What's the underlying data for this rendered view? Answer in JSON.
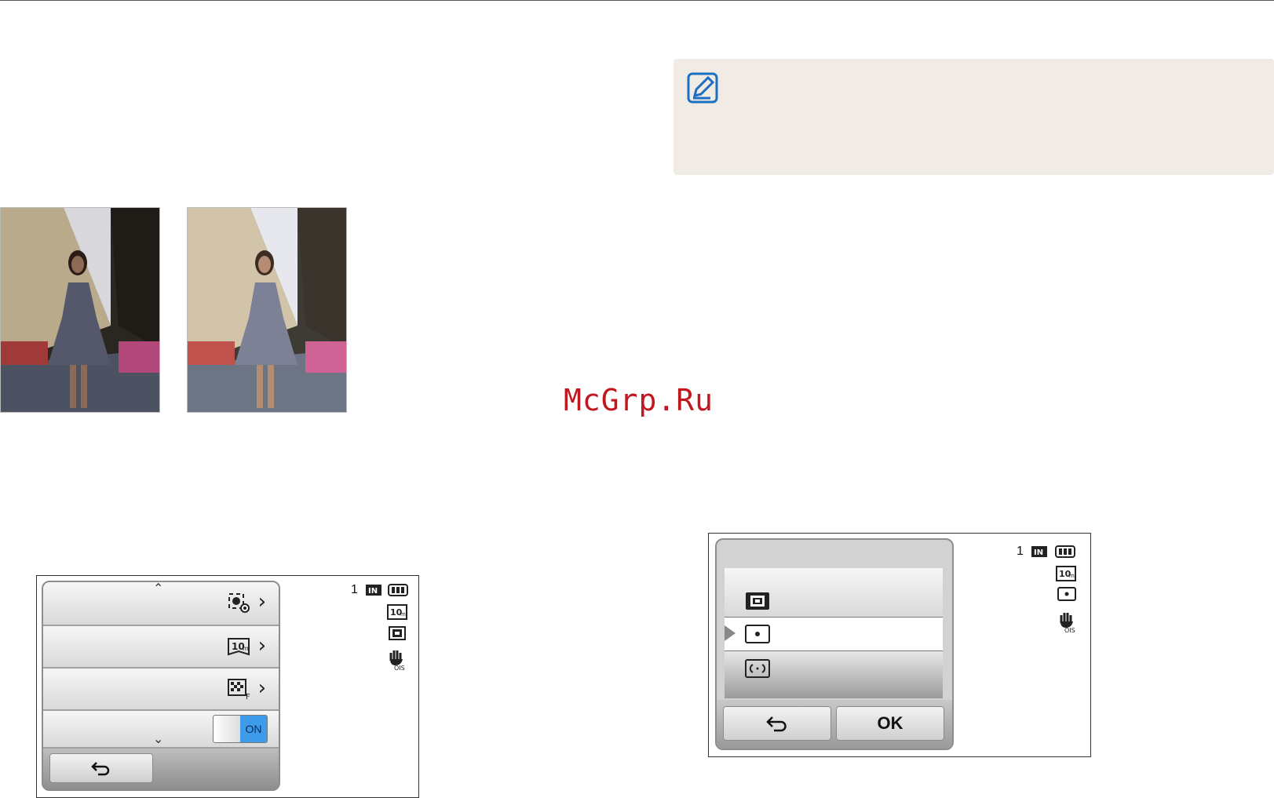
{
  "watermark": "McGrp.Ru",
  "note": {
    "icon": "note-pencil-icon"
  },
  "photos": [
    {
      "name": "photo-example-before"
    },
    {
      "name": "photo-example-after"
    }
  ],
  "screen1": {
    "status": {
      "shots": "1",
      "memory_icon": "internal-memory-icon",
      "battery_icon": "battery-full-icon"
    },
    "side_icons": [
      "resolution-10m-icon",
      "metering-multi-icon",
      "ois-icon"
    ],
    "rows": [
      {
        "icon": "face-detection-icon"
      },
      {
        "icon": "resolution-10m-icon"
      },
      {
        "icon": "quality-fine-icon"
      },
      {
        "toggle": "ON"
      }
    ],
    "scroll_up_icon": "chevron-up-icon",
    "scroll_down_icon": "chevron-down-icon",
    "back_icon": "back-arrow-icon"
  },
  "screen2": {
    "status": {
      "shots": "1",
      "memory_icon": "internal-memory-icon",
      "battery_icon": "battery-full-icon"
    },
    "side_icons": [
      "resolution-10m-icon",
      "metering-spot-icon",
      "ois-icon"
    ],
    "options": [
      {
        "icon": "metering-multi-icon"
      },
      {
        "icon": "metering-spot-icon",
        "selected": true
      },
      {
        "icon": "metering-center-weighted-icon"
      }
    ],
    "back_icon": "back-arrow-icon",
    "ok_label": "OK"
  }
}
